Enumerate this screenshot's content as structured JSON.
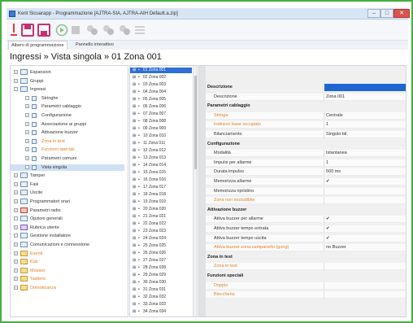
{
  "window": {
    "title": "Kent Sicuarapp - Programmazione [AJTRA-SIA, AJTRA-AIH Default.a.zip]",
    "min_label": "–",
    "max_label": "□",
    "close_label": "✕"
  },
  "toolbar": {
    "icons": [
      "new-icon",
      "save-icon",
      "save-as-icon",
      "connect-icon",
      "stop-icon",
      "upload-icon",
      "download-icon",
      "sync-icon",
      "list-icon"
    ]
  },
  "tabs": [
    "Albero di programmazione",
    "Pannello interattivo"
  ],
  "breadcrumb": "Ingressi » Vista singola » 01 Zona 001",
  "tree": [
    {
      "label": "Espansion",
      "level": 0,
      "expander": "+",
      "icon": "normal",
      "orange": false,
      "selected": false
    },
    {
      "label": "Gruppi",
      "level": 0,
      "expander": "+",
      "icon": "normal",
      "orange": false,
      "selected": false
    },
    {
      "label": "Ingressi",
      "level": 0,
      "expander": "-",
      "icon": "normal",
      "orange": false,
      "selected": false
    },
    {
      "label": "Stringhe",
      "level": 1,
      "expander": "",
      "icon": "small",
      "orange": false,
      "selected": false
    },
    {
      "label": "Parametri cablaggio",
      "level": 1,
      "expander": "+",
      "icon": "small",
      "orange": false,
      "selected": false
    },
    {
      "label": "Configurazione",
      "level": 1,
      "expander": "+",
      "icon": "small",
      "orange": false,
      "selected": false
    },
    {
      "label": "Associazione ai gruppi",
      "level": 1,
      "expander": "+",
      "icon": "small",
      "orange": false,
      "selected": false
    },
    {
      "label": "Attivazione buzzer",
      "level": 1,
      "expander": "+",
      "icon": "small",
      "orange": false,
      "selected": false
    },
    {
      "label": "Zona in test",
      "level": 1,
      "expander": "+",
      "icon": "small",
      "orange": true,
      "selected": false
    },
    {
      "label": "Funzioni speciali",
      "level": 1,
      "expander": "+",
      "icon": "small",
      "orange": true,
      "selected": false
    },
    {
      "label": "Parametri comuni",
      "level": 1,
      "expander": "+",
      "icon": "small",
      "orange": false,
      "selected": false
    },
    {
      "label": "Vista singola",
      "level": 1,
      "expander": "",
      "icon": "small",
      "orange": false,
      "selected": true
    },
    {
      "label": "Tamper",
      "level": 0,
      "expander": "+",
      "icon": "normal",
      "orange": false,
      "selected": false
    },
    {
      "label": "Fasi",
      "level": 0,
      "expander": "+",
      "icon": "normal",
      "orange": false,
      "selected": false
    },
    {
      "label": "Uscite",
      "level": 0,
      "expander": "+",
      "icon": "normal",
      "orange": false,
      "selected": false
    },
    {
      "label": "Programmatori orari",
      "level": 0,
      "expander": "+",
      "icon": "normal",
      "orange": false,
      "selected": false
    },
    {
      "label": "Parametri radio",
      "level": 0,
      "expander": "+",
      "icon": "red",
      "orange": false,
      "selected": false
    },
    {
      "label": "Opzioni generali",
      "level": 0,
      "expander": "",
      "icon": "normal",
      "orange": false,
      "selected": false
    },
    {
      "label": "Rubrica utente",
      "level": 0,
      "expander": "+",
      "icon": "purple",
      "orange": false,
      "selected": false
    },
    {
      "label": "Gestione installatore",
      "level": 0,
      "expander": "",
      "icon": "normal",
      "orange": false,
      "selected": false
    },
    {
      "label": "Comunicazioni e connessione",
      "level": 0,
      "expander": "+",
      "icon": "normal",
      "orange": false,
      "selected": false
    },
    {
      "label": "Eventi",
      "level": 0,
      "expander": "+",
      "icon": "folder",
      "orange": true,
      "selected": false
    },
    {
      "label": "Ksb",
      "level": 0,
      "expander": "+",
      "icon": "folder",
      "orange": true,
      "selected": false
    },
    {
      "label": "Mosaici",
      "level": 0,
      "expander": "+",
      "icon": "folder",
      "orange": true,
      "selected": false
    },
    {
      "label": "Tastiere",
      "level": 0,
      "expander": "+",
      "icon": "folder",
      "orange": true,
      "selected": false
    },
    {
      "label": "Domoticanza",
      "level": 0,
      "expander": "+",
      "icon": "folder",
      "orange": true,
      "selected": false
    }
  ],
  "zones": [
    "01 Zona 001",
    "02 Zona 002",
    "03 Zona 003",
    "04 Zona 004",
    "05 Zona 005",
    "06 Zona 006",
    "07 Zona 007",
    "08 Zona 008",
    "09 Zona 009",
    "10 Zona 010",
    "11 Zona 011",
    "12 Zona 012",
    "13 Zona 013",
    "14 Zona 014",
    "15 Zona 015",
    "16 Zona 016",
    "17 Zona 017",
    "18 Zona 018",
    "19 Zona 019",
    "20 Zona 020",
    "21 Zona 021",
    "22 Zona 022",
    "23 Zona 023",
    "24 Zona 024",
    "25 Zona 025",
    "26 Zona 026",
    "27 Zona 027",
    "28 Zona 028",
    "29 Zona 029",
    "30 Zona 030",
    "31 Zona 031",
    "32 Zona 032",
    "33 Zona 033",
    "34 Zona 034"
  ],
  "properties": [
    {
      "type": "cat",
      "name": "Descrizione",
      "value": ""
    },
    {
      "type": "item",
      "name": "Descrizione",
      "value": "Zona 001",
      "orange": false
    },
    {
      "type": "cat",
      "name": "Parametri cablaggio",
      "value": ""
    },
    {
      "type": "item",
      "name": "Stringa",
      "value": "Centrale",
      "orange": true
    },
    {
      "type": "item",
      "name": "Indirizzo base occupato",
      "value": "1",
      "orange": true
    },
    {
      "type": "item",
      "name": "Bilanciamento",
      "value": "Singolo bil.",
      "orange": false
    },
    {
      "type": "cat",
      "name": "Configurazione",
      "value": ""
    },
    {
      "type": "item",
      "name": "Modalità",
      "value": "Istantanea",
      "orange": false
    },
    {
      "type": "item",
      "name": "Impulsi per allarme",
      "value": "1",
      "orange": false
    },
    {
      "type": "item",
      "name": "Durata impulso",
      "value": "500 ms",
      "orange": false
    },
    {
      "type": "item",
      "name": "Memorizza allarme",
      "value": "✔",
      "orange": false
    },
    {
      "type": "item",
      "name": "Memorizza ripristino",
      "value": "",
      "orange": false
    },
    {
      "type": "item",
      "name": "Zona non escludibile",
      "value": "",
      "orange": true
    },
    {
      "type": "cat",
      "name": "Attivazione buzzer",
      "value": ""
    },
    {
      "type": "item",
      "name": "Attiva buzzer per allarme",
      "value": "✔",
      "orange": false
    },
    {
      "type": "item",
      "name": "Attiva buzzer tempo entrata",
      "value": "✔",
      "orange": false
    },
    {
      "type": "item",
      "name": "Attiva buzzer tempo uscita",
      "value": "✔",
      "orange": false
    },
    {
      "type": "item",
      "name": "Attiva buzzer zona campanello (gong)",
      "value": "no Buzzer",
      "orange": true
    },
    {
      "type": "cat",
      "name": "Zona in test",
      "value": ""
    },
    {
      "type": "item",
      "name": "Zona in test",
      "value": "",
      "orange": true
    },
    {
      "type": "cat",
      "name": "Funzioni speciali",
      "value": ""
    },
    {
      "type": "item",
      "name": "Doppio",
      "value": "",
      "orange": true
    },
    {
      "type": "item",
      "name": "Bloccheria",
      "value": "",
      "orange": true
    }
  ]
}
